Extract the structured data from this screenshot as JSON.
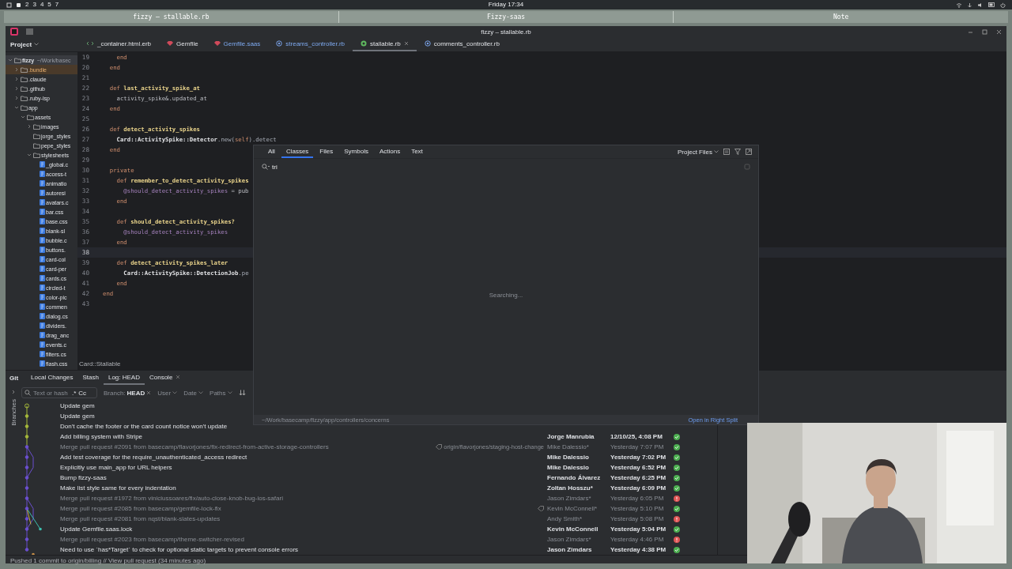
{
  "desktop": {
    "workspaces": [
      "2",
      "3",
      "4",
      "5",
      "7"
    ],
    "clock": "Friday 17:34"
  },
  "window_titles": [
    "fizzy – stallable.rb",
    "Fizzy-saas",
    "Note"
  ],
  "ide": {
    "title": "fizzy – stallable.rb",
    "project_label": "Project",
    "tabs": [
      {
        "label": "_container.html.erb",
        "kind": "erb",
        "modified": false,
        "selected": false
      },
      {
        "label": "Gemfile",
        "kind": "gem",
        "modified": false,
        "selected": false
      },
      {
        "label": "Gemfile.saas",
        "kind": "gem",
        "modified": true,
        "selected": false
      },
      {
        "label": "streams_controller.rb",
        "kind": "controller",
        "modified": true,
        "selected": false
      },
      {
        "label": "stallable.rb",
        "kind": "module",
        "modified": false,
        "selected": true
      },
      {
        "label": "comments_controller.rb",
        "kind": "controller",
        "modified": false,
        "selected": false
      }
    ],
    "tree": [
      {
        "name": "fizzy",
        "path": "~/Work/basec",
        "kind": "folder",
        "expanded": true,
        "children": [
          {
            "name": ".bundle",
            "kind": "folder",
            "expanded": false,
            "excluded": true
          },
          {
            "name": ".claude",
            "kind": "folder",
            "expanded": false,
            "excluded": false
          },
          {
            "name": ".github",
            "kind": "folder",
            "expanded": false,
            "excluded": false
          },
          {
            "name": ".ruby-lsp",
            "kind": "folder",
            "expanded": false,
            "excluded": false
          },
          {
            "name": "app",
            "kind": "folder",
            "expanded": true,
            "excluded": false,
            "children": [
              {
                "name": "assets",
                "kind": "folder",
                "expanded": true,
                "children": [
                  {
                    "name": "images",
                    "kind": "folder",
                    "expanded": false
                  },
                  {
                    "name": "jorge_styles",
                    "kind": "folder"
                  },
                  {
                    "name": "pepe_styles",
                    "kind": "folder"
                  },
                  {
                    "name": "stylesheets",
                    "kind": "folder",
                    "expanded": true,
                    "children": [
                      {
                        "name": "_global.c",
                        "kind": "css"
                      },
                      {
                        "name": "access-t",
                        "kind": "css"
                      },
                      {
                        "name": "animatio",
                        "kind": "css"
                      },
                      {
                        "name": "autoresi",
                        "kind": "css"
                      },
                      {
                        "name": "avatars.c",
                        "kind": "css"
                      },
                      {
                        "name": "bar.css",
                        "kind": "css"
                      },
                      {
                        "name": "base.css",
                        "kind": "css"
                      },
                      {
                        "name": "blank-sl",
                        "kind": "css"
                      },
                      {
                        "name": "bubble.c",
                        "kind": "css"
                      },
                      {
                        "name": "buttons.",
                        "kind": "css"
                      },
                      {
                        "name": "card-col",
                        "kind": "css"
                      },
                      {
                        "name": "card-per",
                        "kind": "css"
                      },
                      {
                        "name": "cards.cs",
                        "kind": "css"
                      },
                      {
                        "name": "circled-t",
                        "kind": "css"
                      },
                      {
                        "name": "color-pic",
                        "kind": "css"
                      },
                      {
                        "name": "commen",
                        "kind": "css"
                      },
                      {
                        "name": "dialog.cs",
                        "kind": "css"
                      },
                      {
                        "name": "dividers.",
                        "kind": "css"
                      },
                      {
                        "name": "drag_anc",
                        "kind": "css"
                      },
                      {
                        "name": "events.c",
                        "kind": "css"
                      },
                      {
                        "name": "filters.cs",
                        "kind": "css"
                      },
                      {
                        "name": "flash.css",
                        "kind": "css"
                      }
                    ]
                  }
                ]
              }
            ]
          }
        ]
      }
    ],
    "code": [
      {
        "n": "19",
        "current": false,
        "tokens": [
          {
            "kind": "kw",
            "text": "    end"
          }
        ]
      },
      {
        "n": "20",
        "current": false,
        "tokens": [
          {
            "kind": "kw",
            "text": "  end"
          }
        ]
      },
      {
        "n": "21",
        "current": false
      },
      {
        "n": "22",
        "current": false,
        "tokens": [
          {
            "kind": "kw",
            "text": "  def "
          },
          {
            "kind": "fn",
            "text": "last_activity_spike_at"
          }
        ]
      },
      {
        "n": "23",
        "current": false,
        "tokens": [
          {
            "kind": "plain",
            "text": "    activity_spike&.updated_at"
          }
        ]
      },
      {
        "n": "24",
        "current": false,
        "tokens": [
          {
            "kind": "kw",
            "text": "  end"
          }
        ]
      },
      {
        "n": "25",
        "current": false
      },
      {
        "n": "26",
        "current": false,
        "tokens": [
          {
            "kind": "kw",
            "text": "  def "
          },
          {
            "kind": "fn",
            "text": "detect_activity_spikes"
          }
        ]
      },
      {
        "n": "27",
        "current": false,
        "tokens": [
          {
            "kind": "const",
            "text": "    Card::ActivitySpike::Detector"
          },
          {
            "kind": "punct",
            "text": ".new("
          },
          {
            "kind": "kw",
            "text": "self"
          },
          {
            "kind": "punct",
            "text": ").detect"
          }
        ]
      },
      {
        "n": "28",
        "current": false,
        "tokens": [
          {
            "kind": "kw",
            "text": "  end"
          }
        ]
      },
      {
        "n": "29",
        "current": false
      },
      {
        "n": "30",
        "current": false,
        "tokens": [
          {
            "kind": "kw",
            "text": "  private"
          }
        ]
      },
      {
        "n": "31",
        "current": false,
        "tokens": [
          {
            "kind": "kw",
            "text": "    def "
          },
          {
            "kind": "fn",
            "text": "remember_to_detect_activity_spikes"
          }
        ]
      },
      {
        "n": "32",
        "current": false,
        "tokens": [
          {
            "kind": "ivar",
            "text": "      @should_detect_activity_spikes"
          },
          {
            "kind": "plain",
            "text": " = pub"
          }
        ]
      },
      {
        "n": "33",
        "current": false,
        "tokens": [
          {
            "kind": "kw",
            "text": "    end"
          }
        ]
      },
      {
        "n": "34",
        "current": false
      },
      {
        "n": "35",
        "current": false,
        "tokens": [
          {
            "kind": "kw",
            "text": "    def "
          },
          {
            "kind": "fn",
            "text": "should_detect_activity_spikes?"
          }
        ]
      },
      {
        "n": "36",
        "current": false,
        "tokens": [
          {
            "kind": "ivar",
            "text": "      @should_detect_activity_spikes"
          }
        ]
      },
      {
        "n": "37",
        "current": false,
        "tokens": [
          {
            "kind": "kw",
            "text": "    end"
          }
        ]
      },
      {
        "n": "38",
        "current": true
      },
      {
        "n": "39",
        "current": false,
        "tokens": [
          {
            "kind": "kw",
            "text": "    def "
          },
          {
            "kind": "fn",
            "text": "detect_activity_spikes_later"
          }
        ]
      },
      {
        "n": "40",
        "current": false,
        "tokens": [
          {
            "kind": "const",
            "text": "      Card::ActivitySpike::DetectionJob"
          },
          {
            "kind": "punct",
            "text": ".pe"
          }
        ]
      },
      {
        "n": "41",
        "current": false,
        "tokens": [
          {
            "kind": "kw",
            "text": "    end"
          }
        ]
      },
      {
        "n": "42",
        "current": false,
        "tokens": [
          {
            "kind": "kw",
            "text": "end"
          }
        ]
      },
      {
        "n": "43",
        "current": false
      }
    ],
    "breadcrumb": "Card::Stallable"
  },
  "git": {
    "title": "Git",
    "tabs": [
      {
        "label": "Local Changes",
        "selected": false,
        "closable": false
      },
      {
        "label": "Stash",
        "selected": false,
        "closable": false
      },
      {
        "label": "Log: HEAD",
        "selected": true,
        "closable": false
      },
      {
        "label": "Console",
        "selected": false,
        "closable": true
      }
    ],
    "side_label": "Branches",
    "filter": {
      "placeholder": "Text or hash",
      "regex": ".*",
      "case": "Cc",
      "branch_label": "Branch:",
      "branch": "HEAD",
      "user": "User",
      "date": "Date",
      "paths": "Paths"
    },
    "commits": [
      {
        "message": "Update gem",
        "faded": false,
        "tag": false
      },
      {
        "message": "Update gem",
        "faded": false,
        "tag": false
      },
      {
        "message": "Don't cache the footer or the card count notice won't update",
        "faded": false,
        "tag": false
      },
      {
        "message": "Add billing system with Stripe",
        "faded": false,
        "tag": false,
        "author": "Jorge Manrubia",
        "date": "12/10/25, 4:08 PM",
        "failed": false
      },
      {
        "message": "Merge pull request #2091 from basecamp/flavorjones/fix-redirect-from-active-storage-controllers",
        "faded": true,
        "tag": true,
        "ref": "origin/flavorjones/staging-host-change",
        "author": "Mike Dalessio*",
        "date": "Yesterday 7:07 PM",
        "failed": false
      },
      {
        "message": "Add test coverage for the require_unauthenticated_access redirect",
        "faded": false,
        "tag": false,
        "author": "Mike Dalessio",
        "date": "Yesterday 7:02 PM",
        "failed": false
      },
      {
        "message": "Explicitly use main_app for URL helpers",
        "faded": false,
        "tag": false,
        "author": "Mike Dalessio",
        "date": "Yesterday 6:52 PM",
        "failed": false
      },
      {
        "message": "Bump fizzy-saas",
        "faded": false,
        "tag": false,
        "author": "Fernando Álvarez",
        "date": "Yesterday 6:25 PM",
        "failed": false
      },
      {
        "message": "Make list style same for every indentation",
        "faded": false,
        "tag": false,
        "author": "Zoltan Hosszu*",
        "date": "Yesterday 6:09 PM",
        "failed": false
      },
      {
        "message": "Merge pull request #1972 from viniciussoares/fix/auto-close-knob-bug-ios-safari",
        "faded": true,
        "tag": false,
        "author": "Jason Zimdars*",
        "date": "Yesterday 6:05 PM",
        "failed": true
      },
      {
        "message": "Merge pull request #2085 from basecamp/gemfile-lock-fix",
        "faded": true,
        "tag": true,
        "author": "Kevin McConnell*",
        "date": "Yesterday 5:10 PM",
        "failed": false
      },
      {
        "message": "Merge pull request #2081 from nqst/blank-slates-updates",
        "faded": true,
        "tag": false,
        "author": "Andy Smith*",
        "date": "Yesterday 5:08 PM",
        "failed": true
      },
      {
        "message": "Update Gemfile.saas.lock",
        "faded": false,
        "tag": false,
        "author": "Kevin McConnell",
        "date": "Yesterday 5:04 PM",
        "failed": false
      },
      {
        "message": "Merge pull request #2023 from basecamp/theme-switcher-revised",
        "faded": true,
        "tag": false,
        "author": "Jason Zimdars*",
        "date": "Yesterday 4:46 PM",
        "failed": true
      },
      {
        "message": "Need to use `has*Target` to check for optional static targets to prevent console errors",
        "faded": false,
        "tag": false,
        "author": "Jason Zimdars",
        "date": "Yesterday 4:38 PM",
        "failed": false
      }
    ]
  },
  "status_bar": "Pushed 1 commit to origin/billing // View pull request (34 minutes ago)",
  "search_popup": {
    "tabs": [
      {
        "label": "All",
        "selected": false
      },
      {
        "label": "Classes",
        "selected": true
      },
      {
        "label": "Files",
        "selected": false
      },
      {
        "label": "Symbols",
        "selected": false
      },
      {
        "label": "Actions",
        "selected": false
      },
      {
        "label": "Text",
        "selected": false
      }
    ],
    "scope": "Project Files",
    "query": "tri",
    "message": "Searching...",
    "path": "~/Work/basecamp/fizzy/app/controllers/concerns",
    "open_link": "Open in Right Split"
  },
  "webcam": {
    "kind": "picture"
  }
}
